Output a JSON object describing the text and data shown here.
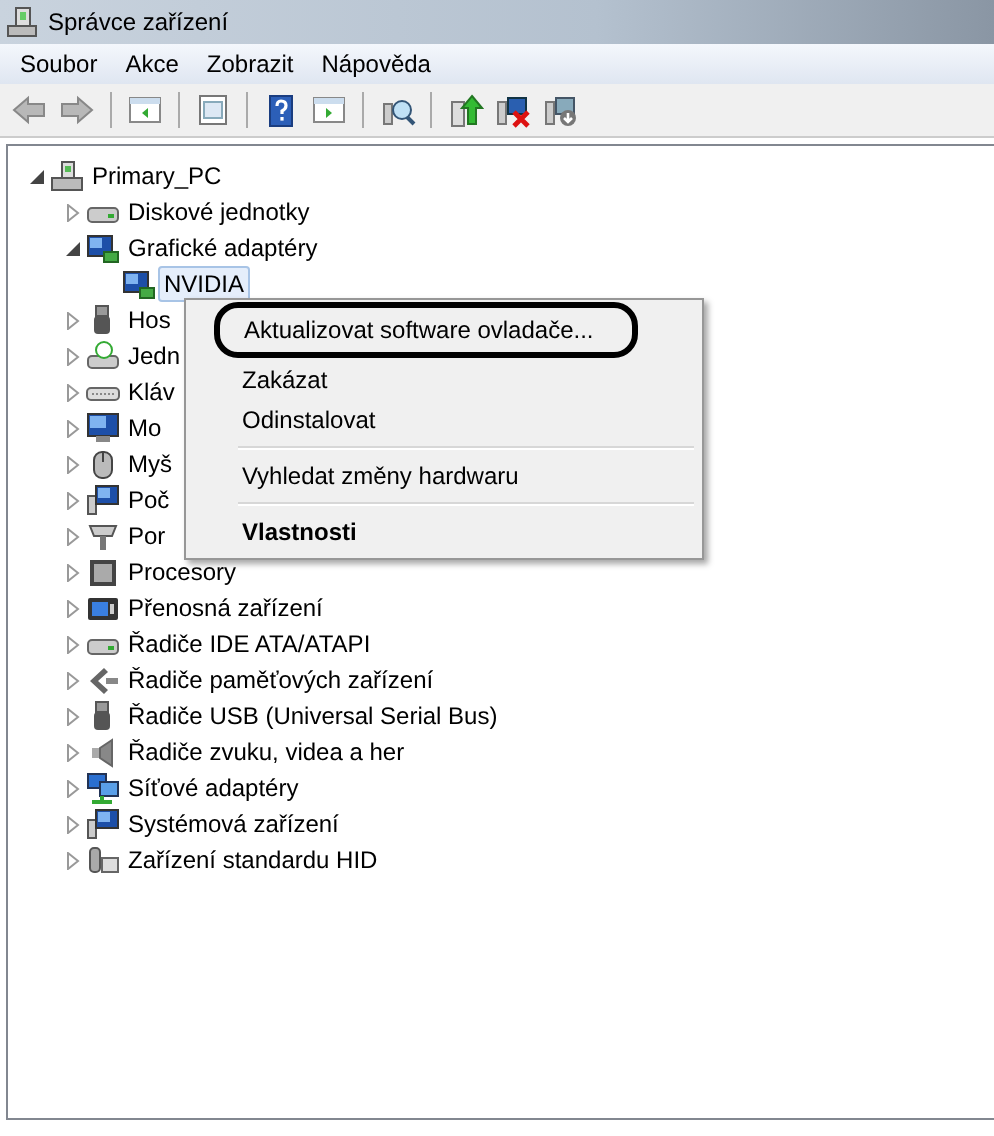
{
  "window": {
    "title": "Správce zařízení"
  },
  "menu_bar": [
    "Soubor",
    "Akce",
    "Zobrazit",
    "Nápověda"
  ],
  "toolbar": [
    {
      "kind": "back"
    },
    {
      "kind": "forward"
    },
    {
      "kind": "separator"
    },
    {
      "kind": "tree"
    },
    {
      "kind": "separator"
    },
    {
      "kind": "properties"
    },
    {
      "kind": "separator"
    },
    {
      "kind": "help"
    },
    {
      "kind": "pane"
    },
    {
      "kind": "separator"
    },
    {
      "kind": "scan"
    },
    {
      "kind": "separator"
    },
    {
      "kind": "update"
    },
    {
      "kind": "uninstall"
    },
    {
      "kind": "add"
    }
  ],
  "tree": {
    "label": "Primary_PC",
    "kind": "computer",
    "expanded": true,
    "children": [
      {
        "label": "Diskové jednotky",
        "kind": "disk",
        "expanded": false
      },
      {
        "label": "Grafické adaptéry",
        "kind": "display",
        "expanded": true,
        "children": [
          {
            "label": "NVIDIA",
            "kind": "display",
            "selected": true
          }
        ]
      },
      {
        "label": "Hos",
        "kind": "usb",
        "expanded": false
      },
      {
        "label": "Jedn",
        "kind": "drive",
        "expanded": false
      },
      {
        "label": "Kláv",
        "kind": "keyboard",
        "expanded": false
      },
      {
        "label": "Mo",
        "kind": "monitor",
        "expanded": false
      },
      {
        "label": "Myš",
        "kind": "mouse",
        "expanded": false
      },
      {
        "label": "Poč",
        "kind": "computer2",
        "expanded": false
      },
      {
        "label": "Por",
        "kind": "port",
        "expanded": false
      },
      {
        "label": "Procesory",
        "kind": "cpu",
        "expanded": false
      },
      {
        "label": "Přenosná zařízení",
        "kind": "portable",
        "expanded": false
      },
      {
        "label": "Řadiče IDE ATA/ATAPI",
        "kind": "disk",
        "expanded": false
      },
      {
        "label": "Řadiče paměťových zařízení",
        "kind": "storage",
        "expanded": false
      },
      {
        "label": "Řadiče USB (Universal Serial Bus)",
        "kind": "usb",
        "expanded": false
      },
      {
        "label": "Řadiče zvuku, videa a her",
        "kind": "speaker",
        "expanded": false
      },
      {
        "label": "Síťové adaptéry",
        "kind": "network",
        "expanded": false
      },
      {
        "label": "Systémová zařízení",
        "kind": "computer2",
        "expanded": false
      },
      {
        "label": "Zařízení standardu HID",
        "kind": "hid",
        "expanded": false
      }
    ]
  },
  "context_menu": [
    {
      "kind": "item",
      "label": "Aktualizovat software ovladače...",
      "circled": true
    },
    {
      "kind": "item",
      "label": "Zakázat"
    },
    {
      "kind": "item",
      "label": "Odinstalovat"
    },
    {
      "kind": "separator"
    },
    {
      "kind": "item",
      "label": "Vyhledat změny hardwaru"
    },
    {
      "kind": "separator"
    },
    {
      "kind": "item",
      "label": "Vlastnosti",
      "default": true
    }
  ]
}
